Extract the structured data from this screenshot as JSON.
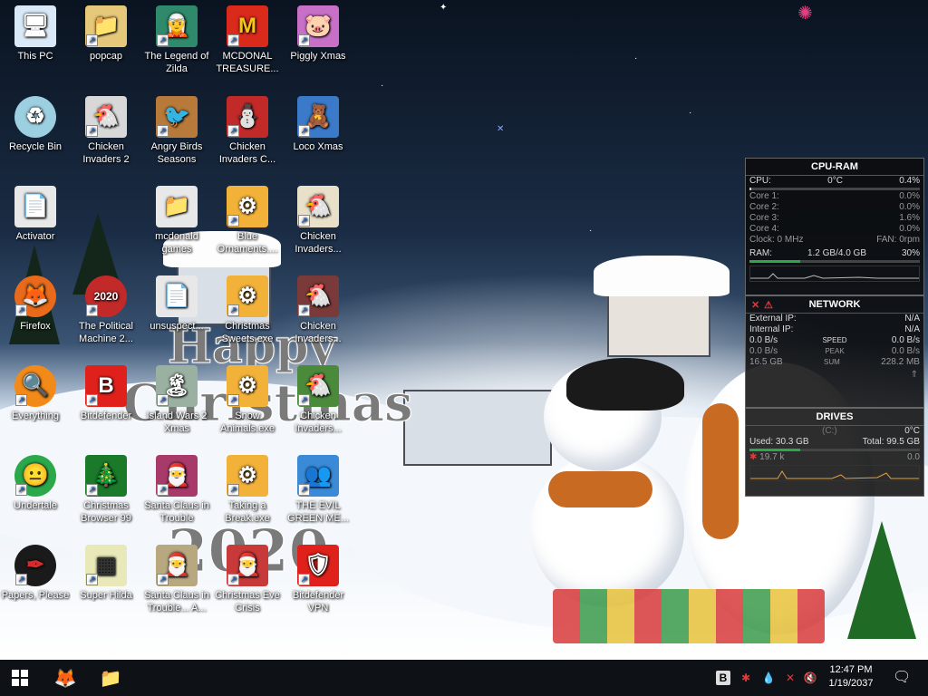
{
  "desktop": {
    "icons": [
      {
        "label": "This PC",
        "icon": "this-pc-icon",
        "glyph": "🖥",
        "bg": "#d9e9f7"
      },
      {
        "label": "popcap",
        "icon": "folder-icon",
        "glyph": "📁",
        "bg": "#e6c87a"
      },
      {
        "label": "The Legend of Zilda",
        "icon": "zelda-game-icon",
        "glyph": "🧝",
        "bg": "#2e8a6a"
      },
      {
        "label": "MCDONAL TREASURE...",
        "icon": "mcdonald-logo-icon",
        "glyph": "M",
        "bg": "#d92a1c"
      },
      {
        "label": "Piggly Xmas",
        "icon": "pig-icon",
        "glyph": "🐷",
        "bg": "#c870c8"
      },
      {
        "label": "Recycle Bin",
        "icon": "recycle-bin-icon",
        "glyph": "♻",
        "bg": "#9ccfe0"
      },
      {
        "label": "Chicken Invaders 2",
        "icon": "chicken-icon",
        "glyph": "🐔",
        "bg": "#d8d8d8"
      },
      {
        "label": "Angry Birds Seasons",
        "icon": "angry-birds-icon",
        "glyph": "🐦",
        "bg": "#b87a3a"
      },
      {
        "label": "Chicken Invaders C...",
        "icon": "snowman-icon",
        "glyph": "⛄",
        "bg": "#c22a2a"
      },
      {
        "label": "Loco Xmas",
        "icon": "bear-icon",
        "glyph": "🧸",
        "bg": "#3a7ac8"
      },
      {
        "label": "Activator",
        "icon": "file-icon",
        "glyph": "📄",
        "bg": "#e8e8e8"
      },
      {
        "label": "mcdonald games",
        "icon": "folder-icon",
        "glyph": "📁",
        "bg": "#e8e8e8"
      },
      {
        "label": "Blue Ornaments....",
        "icon": "exe-icon",
        "glyph": "⚙",
        "bg": "#f2b23a"
      },
      {
        "label": "Chicken Invaders...",
        "icon": "chicken-icon",
        "glyph": "🐔",
        "bg": "#e8e0c8"
      },
      {
        "label": "Firefox",
        "icon": "firefox-icon",
        "glyph": "🦊",
        "bg": "#e86a1a"
      },
      {
        "label": "The Political Machine 2...",
        "icon": "political-machine-icon",
        "glyph": "2020",
        "bg": "#c22a2a"
      },
      {
        "label": "unsuspect...",
        "icon": "file-icon",
        "glyph": "📄",
        "bg": "#e8e8e8"
      },
      {
        "label": "Christmas Sweets.exe",
        "icon": "exe-icon",
        "glyph": "⚙",
        "bg": "#f2b23a"
      },
      {
        "label": "Chicken Invaders...",
        "icon": "chicken-icon",
        "glyph": "🐔",
        "bg": "#7a3a3a"
      },
      {
        "label": "Everything",
        "icon": "magnifier-icon",
        "glyph": "🔍",
        "bg": "#f28a1a"
      },
      {
        "label": "Bitdefender",
        "icon": "bitdefender-icon",
        "glyph": "B",
        "bg": "#e0201a"
      },
      {
        "label": "Island Wars 2 Xmas",
        "icon": "island-icon",
        "glyph": "🏝",
        "bg": "#9ab0a0"
      },
      {
        "label": "Snow Animals.exe",
        "icon": "exe-icon",
        "glyph": "⚙",
        "bg": "#f2b23a"
      },
      {
        "label": "Chicken Invaders...",
        "icon": "chicken-icon",
        "glyph": "🐔",
        "bg": "#4a8a3a"
      },
      {
        "label": "Undertale",
        "icon": "undertale-icon",
        "glyph": "😐",
        "bg": "#2aa84a"
      },
      {
        "label": "Christmas Browser 99",
        "icon": "xmas-tree-icon",
        "glyph": "🎄",
        "bg": "#1a7a2a"
      },
      {
        "label": "Santa Claus in Trouble",
        "icon": "santa-icon",
        "glyph": "🎅",
        "bg": "#a83a6a"
      },
      {
        "label": "Taking a Break.exe",
        "icon": "exe-icon",
        "glyph": "⚙",
        "bg": "#f2b23a"
      },
      {
        "label": "THE EVIL GREEN ME...",
        "icon": "msn-buddy-icon",
        "glyph": "👥",
        "bg": "#3a8ad8"
      },
      {
        "label": "Papers, Please",
        "icon": "papers-please-icon",
        "glyph": "✒",
        "bg": "#1a1a1a"
      },
      {
        "label": "Super Hilda",
        "icon": "pixel-game-icon",
        "glyph": "▦",
        "bg": "#e8e8b8"
      },
      {
        "label": "Santa Claus in Trouble... A...",
        "icon": "santa-icon",
        "glyph": "🎅",
        "bg": "#b8a880"
      },
      {
        "label": "Christmas Eve Crisis",
        "icon": "santa-icon",
        "glyph": "🎅",
        "bg": "#c83a3a"
      },
      {
        "label": "Bitdefender VPN",
        "icon": "vpn-shield-icon",
        "glyph": "🛡",
        "bg": "#e0201a"
      }
    ]
  },
  "wallpaper": {
    "text_line1": "Happy",
    "text_line2": "Christmas",
    "text_line3": "2020"
  },
  "cpu_ram": {
    "title": "CPU-RAM",
    "cpu_label": "CPU:",
    "cpu_temp": "0°C",
    "cpu_pct": "0.4%",
    "cores": [
      {
        "label": "Core 1:",
        "value": "0.0%"
      },
      {
        "label": "Core 2:",
        "value": "0.0%"
      },
      {
        "label": "Core 3:",
        "value": "1.6%"
      },
      {
        "label": "Core 4:",
        "value": "0.0%"
      }
    ],
    "clock": "Clock: 0 MHz",
    "fan": "FAN: 0rpm",
    "ram_label": "RAM:",
    "ram_value": "1.2 GB/4.0 GB",
    "ram_pct": "30%",
    "ram_fraction": 0.3
  },
  "network": {
    "title": "NETWORK",
    "external_label": "External IP:",
    "external_value": "N/A",
    "internal_label": "Internal IP:",
    "internal_value": "N/A",
    "speed_left": "0.0 B/s",
    "speed_label": "SPEED",
    "speed_right": "0.0 B/s",
    "peak_left": "0.0 B/s",
    "peak_label": "PEAK",
    "peak_right": "0.0 B/s",
    "sum_left": "16.5 GB",
    "sum_label": "SUM",
    "sum_right": "228.2 MB"
  },
  "drives": {
    "title": "DRIVES",
    "temp": "0°C",
    "drive_letter": "(C:)",
    "used": "Used: 30.3 GB",
    "total": "Total: 99.5 GB",
    "used_fraction": 0.3,
    "io_left": "19.7 k",
    "io_right": "0.0"
  },
  "taskbar": {
    "time": "12:47 PM",
    "date": "1/19/2037"
  }
}
